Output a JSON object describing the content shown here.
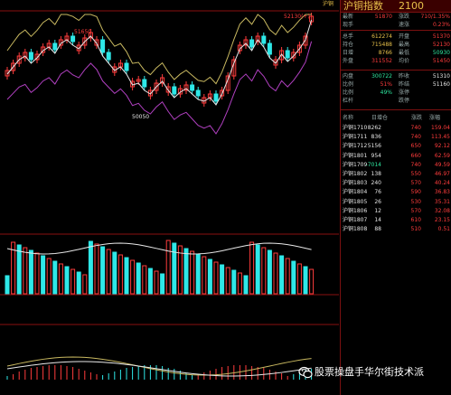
{
  "chart_labels": {
    "price_high": "51650",
    "price_low": "50050",
    "price_top_right": "52130(+)",
    "corner_label": "沪铜"
  },
  "panel": {
    "title": "沪铜指数",
    "code": "2100",
    "stats": [
      {
        "l1": "最新",
        "v1": "51870",
        "c1": "red",
        "l2": "涨跌",
        "v2": "710/1.35%",
        "c2": "red"
      },
      {
        "l1": "现手",
        "v1": "",
        "c1": "white",
        "l2": "速涨",
        "v2": "0.23%",
        "c2": "red"
      },
      {
        "l1": "总手",
        "v1": "612274",
        "c1": "yellow",
        "l2": "开盘",
        "v2": "51370",
        "c2": "red"
      },
      {
        "l1": "持仓",
        "v1": "715488",
        "c1": "yellow",
        "l2": "最高",
        "v2": "52130",
        "c2": "red"
      },
      {
        "l1": "日增",
        "v1": "8766",
        "c1": "yellow",
        "l2": "最低",
        "v2": "50930",
        "c2": "green"
      },
      {
        "l1": "外盘",
        "v1": "311552",
        "c1": "red",
        "l2": "均价",
        "v2": "51450",
        "c2": "red"
      },
      {
        "l1": "内盘",
        "v1": "300722",
        "c1": "green",
        "l2": "昨收",
        "v2": "51310",
        "c2": "white"
      },
      {
        "l1": "比例",
        "v1": "51%",
        "c1": "red",
        "l2": "昨结",
        "v2": "51160",
        "c2": "white"
      },
      {
        "l1": "比例",
        "v1": "49%",
        "c1": "green",
        "l2": "涨停",
        "v2": "",
        "c2": "white"
      },
      {
        "l1": "杠杆",
        "v1": "",
        "c1": "white",
        "l2": "跌停",
        "v2": "",
        "c2": "white"
      }
    ],
    "table_headers": [
      "名称",
      "日增仓",
      "涨跌",
      "涨幅"
    ],
    "table_rows": [
      [
        "沪铜1710",
        "8262",
        "740",
        "159.04"
      ],
      [
        "沪铜1711",
        "836",
        "740",
        "113.45"
      ],
      [
        "沪铜1712",
        "5156",
        "650",
        "92.12"
      ],
      [
        "沪铜1801",
        "954",
        "660",
        "62.59"
      ],
      [
        "沪铜1709",
        "-7014",
        "740",
        "49.59"
      ],
      [
        "沪铜1802",
        "138",
        "550",
        "46.97"
      ],
      [
        "沪铜1803",
        "240",
        "570",
        "40.24"
      ],
      [
        "沪铜1804",
        "76",
        "590",
        "36.83"
      ],
      [
        "沪铜1805",
        "26",
        "530",
        "35.31"
      ],
      [
        "沪铜1806",
        "12",
        "570",
        "32.08"
      ],
      [
        "沪铜1807",
        "14",
        "610",
        "23.15"
      ],
      [
        "沪铜1808",
        "88",
        "510",
        "0.51"
      ]
    ]
  },
  "watermark": {
    "text": "股票操盘手华尔街技术派"
  },
  "colors": {
    "up": "#ff3c3c",
    "down": "#2ee8e8",
    "ma": "#e8e8e8",
    "band_upper": "#c8b860",
    "band_lower": "#b040c0",
    "grid": "#8a1010"
  }
}
